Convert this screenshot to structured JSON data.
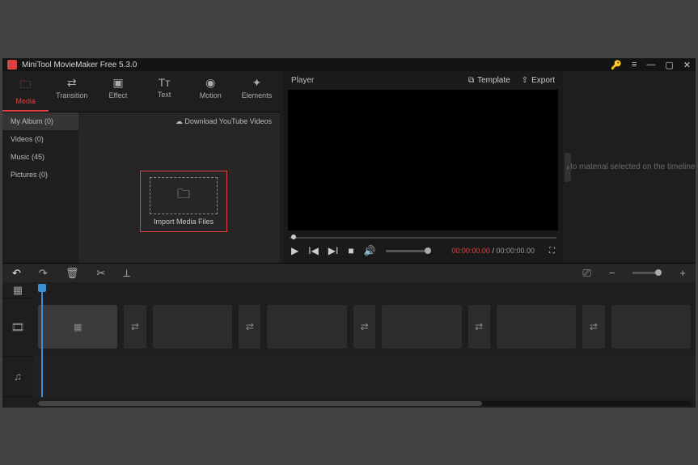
{
  "titlebar": {
    "title": "MiniTool MovieMaker Free 5.3.0"
  },
  "tabs": [
    {
      "label": "Media",
      "icon": "🗀"
    },
    {
      "label": "Transition",
      "icon": "⇄"
    },
    {
      "label": "Effect",
      "icon": "▣"
    },
    {
      "label": "Text",
      "icon": "Tᴛ"
    },
    {
      "label": "Motion",
      "icon": "◉"
    },
    {
      "label": "Elements",
      "icon": "✦"
    }
  ],
  "sidebar": {
    "items": [
      {
        "label": "My Album (0)"
      },
      {
        "label": "Videos (0)"
      },
      {
        "label": "Music (45)"
      },
      {
        "label": "Pictures (0)"
      }
    ]
  },
  "media": {
    "download_link": "Download YouTube Videos",
    "import_label": "Import Media Files"
  },
  "player": {
    "title": "Player",
    "template_label": "Template",
    "export_label": "Export",
    "time_current": "00:00:00.00",
    "time_separator": " / ",
    "time_total": "00:00:00.00"
  },
  "properties": {
    "empty_text": "No material selected on the timeline"
  }
}
